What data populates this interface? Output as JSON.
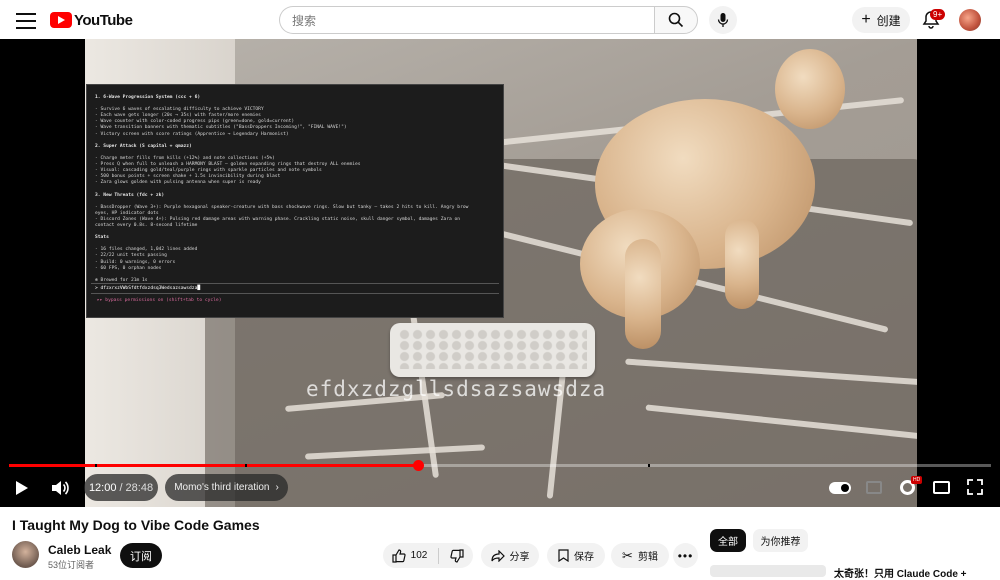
{
  "header": {
    "logo_text": "YouTube",
    "search_placeholder": "搜索",
    "create_label": "创建",
    "notification_count": "9+"
  },
  "terminal": {
    "lines": [
      "1. 6-Wave Progression System (ccc + 6)",
      "",
      "- Survive 6 waves of escalating difficulty to achieve VICTORY",
      "- Each wave gets longer (20s → 35s) with faster/more enemies",
      "- Wave counter with color-coded progress pips (green=done, gold=current)",
      "- Wave transition banners with thematic subtitles (\"BassDroppers Incoming!\", \"FINAL WAVE!\")",
      "- Victory screen with score ratings (Apprentice → Legendary Harmonist)",
      "",
      "2. Super Attack (S capital + qmazz)",
      "",
      "- Charge meter fills from kills (+12%) and note collections (+5%)",
      "- Press Q when full to unleash a HARMONY BLAST — golden expanding rings that destroy ALL enemies",
      "- Visual: cascading gold/teal/purple rings with sparkle particles and note symbols",
      "- 500 bonus points + screen shake + 1.5s invincibility during blast",
      "- Zara glows golden with pulsing antenna when super is ready",
      "",
      "3. New Threats (fdc + zk)",
      "",
      "- BassDropper (Wave 3+): Purple hexagonal speaker-creature with bass shockwave rings. Slow but tanky — takes 2 hits to kill. Angry brow",
      "eyes, HP indicator dots",
      "- Discord Zones (Wave 4+): Pulsing red damage areas with warning phase. Crackling static noise, skull danger symbol, damages Zara on",
      "contact every 0.8s. 8-second lifetime",
      "",
      "Stats",
      "",
      "- 16 files changed, 1,042 lines added",
      "- 22/22 unit tests passing",
      "- Build: 0 warnings, 0 errors",
      "- 60 FPS, 0 orphan nodes",
      "",
      "✻ Brewed for 21m 1s"
    ],
    "prompt": "> dfzxrxzVWbSfdtfdxzdsq3Wedsazsawsdza█",
    "hint": "▸▸ bypass permissions on (shift+tab to cycle)"
  },
  "overlay_text": "efdxzdzgllsdsazsawsdza",
  "player": {
    "current_time": "12:00",
    "separator": "/",
    "duration": "28:48",
    "chapter": "Momo's third iteration",
    "progress_fraction": 0.4167,
    "hd_label": "HD"
  },
  "video": {
    "title": "I Taught My Dog to Vibe Code Games"
  },
  "channel": {
    "name": "Caleb Leak",
    "subscribers": "53位订阅者",
    "subscribe_label": "订阅"
  },
  "actions": {
    "like_count": "102",
    "share_label": "分享",
    "save_label": "保存",
    "clip_label": "剪辑"
  },
  "sidebar": {
    "chips": [
      "全部",
      "为你推荐"
    ],
    "first_rec_title": "太奇张！只用 Claude Code +"
  },
  "colors": {
    "brand_red": "#ff0000",
    "progress_red": "#ff0000"
  }
}
